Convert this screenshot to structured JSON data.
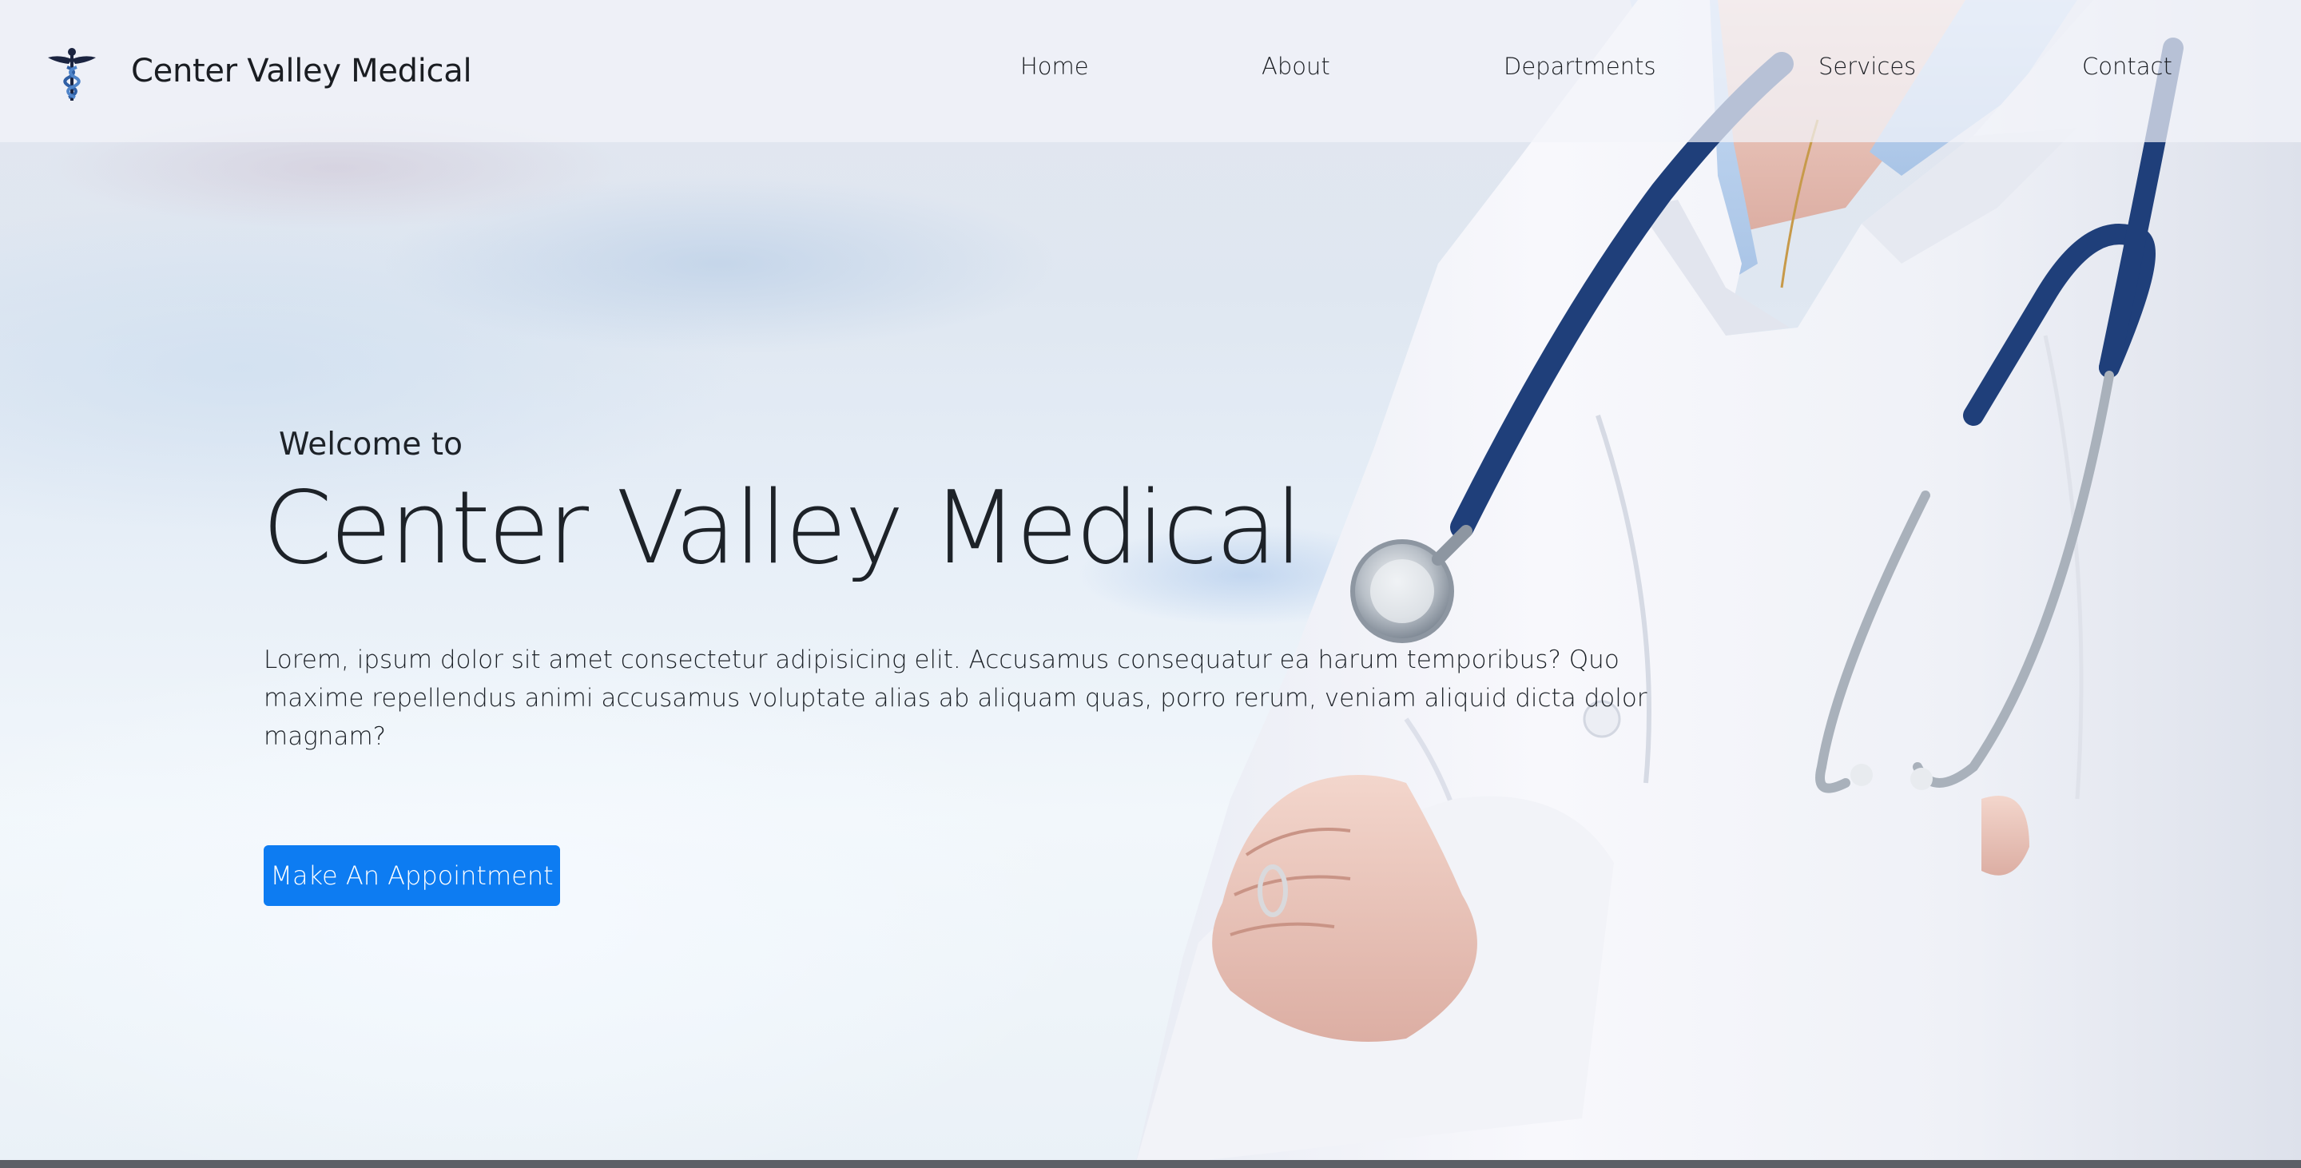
{
  "header": {
    "brand_name": "Center Valley Medical",
    "logo_icon": "caduceus-icon",
    "nav": [
      {
        "label": "Home"
      },
      {
        "label": "About"
      },
      {
        "label": "Departments"
      },
      {
        "label": "Services"
      },
      {
        "label": "Contact"
      }
    ]
  },
  "hero": {
    "eyebrow": "Welcome to",
    "title": "Center Valley Medical",
    "description": "Lorem, ipsum dolor sit amet consectetur adipisicing elit. Accusamus consequatur ea harum temporibus? Quo maxime repellendus animi accusamus voluptate alias ab aliquam quas, porro rerum, veniam aliquid dicta dolor magnam?",
    "cta_label": "Make An Appointment",
    "background_image": "doctor-with-stethoscope-photo"
  },
  "colors": {
    "accent": "#0d7cf2",
    "text": "#1d2228",
    "stethoscope": "#1f3f7a"
  }
}
